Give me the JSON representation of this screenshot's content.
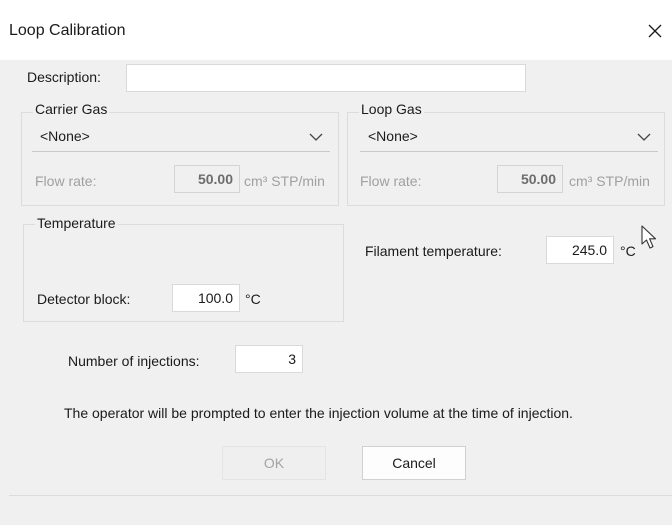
{
  "window": {
    "title": "Loop Calibration",
    "close_icon": "close-icon"
  },
  "description": {
    "label": "Description:",
    "value": ""
  },
  "carrier_gas": {
    "group_label": "Carrier Gas",
    "selected": "<None>",
    "flow_label": "Flow rate:",
    "flow_value": "50.00",
    "flow_unit": "cm³ STP/min"
  },
  "loop_gas": {
    "group_label": "Loop Gas",
    "selected": "<None>",
    "flow_label": "Flow rate:",
    "flow_value": "50.00",
    "flow_unit": "cm³ STP/min"
  },
  "temperature": {
    "group_label": "Temperature",
    "detector_label": "Detector block:",
    "detector_value": "100.0",
    "detector_unit": "°C",
    "filament_label": "Filament temperature:",
    "filament_value": "245.0",
    "filament_unit": "°C"
  },
  "injections": {
    "label": "Number of injections:",
    "value": "3"
  },
  "message": "The operator will be prompted to enter the injection volume at the time of injection.",
  "buttons": {
    "ok_label": "OK",
    "cancel_label": "Cancel"
  },
  "colors": {
    "dialog_background": "#f0f0f0",
    "titlebar_background": "#ffffff",
    "disabled_text": "#a0a0a0"
  }
}
